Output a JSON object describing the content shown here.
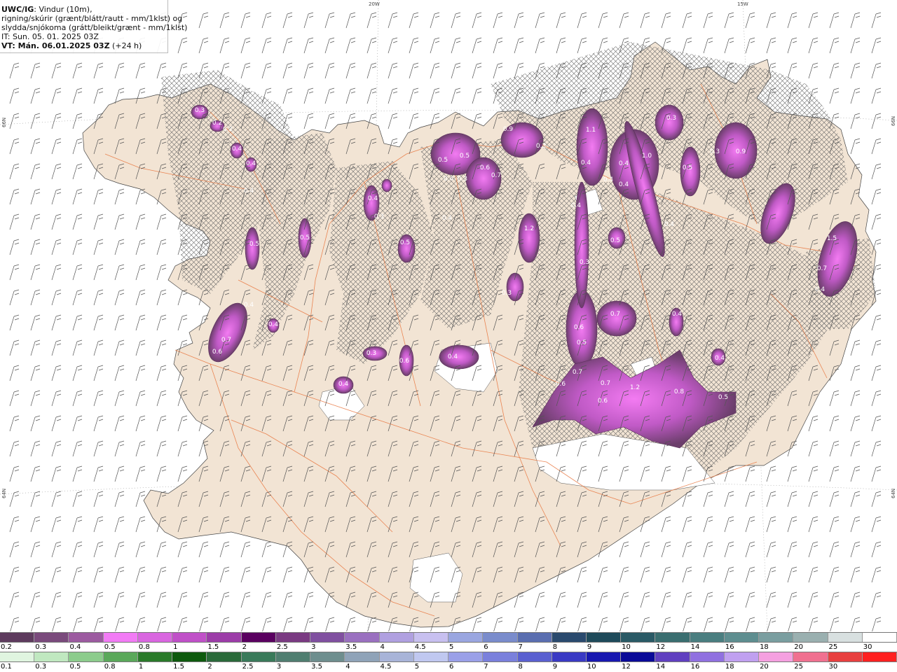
{
  "header": {
    "code": "UWC/IG",
    "line1_rest": ": Vindur (10m),",
    "line2": "rigning/skúrir (grænt/blátt/rautt - mm/1klst) og",
    "line3": "slydda/snjókoma (grátt/bleikt/grænt - mm/1klst)",
    "it": "IT: Sun. 05. 01. 2025 03Z",
    "vt": "VT: Mán. 06.01.2025 03Z",
    "vt_offset": " (+24 h)"
  },
  "grid_labels": {
    "lon_20w": "20W",
    "lon_15w": "15W",
    "lat_66n_left": "66N",
    "lat_66n_right": "66N",
    "lat_64n_left": "64N",
    "lat_64n_right": "64N"
  },
  "snow_values": [
    "0.3",
    "0.2",
    "0.2",
    "0.4",
    "0.4",
    "0.4",
    "0.5",
    "0.5",
    "0.4",
    "0.6",
    "0.7",
    "0.4",
    "0.3",
    "0.5",
    "0.5",
    "0.3",
    "0.9",
    "0.3",
    "1.2",
    "0.3",
    "0.4",
    "0.5",
    "1.1",
    "0.4",
    "1.0",
    "0.4",
    "0.4",
    "0.4",
    "0.5",
    "0.3",
    "0.9",
    "0.3",
    "0.4",
    "1.5",
    "0.7",
    "0.4",
    "0.6",
    "0.5",
    "0.5",
    "0.4",
    "0.4",
    "0.7",
    "0.4",
    "0.6",
    "0.7",
    "0.4",
    "0.3",
    "0.4",
    "0.6",
    "0.7",
    "0.7",
    "1.2",
    "0.8",
    "0.5",
    "0.4",
    "0.4",
    "0.3",
    "0.6",
    "0.6"
  ],
  "legend_top": {
    "scheme": "snow (grey/pink/green)",
    "labels": [
      "0.2",
      "0.3",
      "0.4",
      "0.5",
      "0.8",
      "1",
      "1.5",
      "2",
      "2.5",
      "3",
      "3.5",
      "4",
      "4.5",
      "5",
      "6",
      "7",
      "8",
      "9",
      "10",
      "12",
      "14",
      "16",
      "18",
      "20",
      "25",
      "30"
    ],
    "colors": [
      "#5e3b5e",
      "#7a4a7c",
      "#9c5aa0",
      "#f27bf5",
      "#d966e0",
      "#c050c8",
      "#9c3ca8",
      "#5a0060",
      "#7a3a82",
      "#8050a0",
      "#9a70c0",
      "#b0a0e0",
      "#c8c0f0",
      "#9aa6e0",
      "#7a8ccc",
      "#5a6eb0",
      "#2a4a6e",
      "#1e4a5a",
      "#2a5a66",
      "#3a6e70",
      "#4a7e80",
      "#5e8e90",
      "#7a9ea0",
      "#9ab0b0",
      "#d8e0e0",
      "#ffffff"
    ]
  },
  "legend_bottom": {
    "scheme": "rain (green/blue/red)",
    "labels": [
      "0.1",
      "0.3",
      "0.5",
      "0.8",
      "1",
      "1.5",
      "2",
      "2.5",
      "3",
      "3.5",
      "4",
      "4.5",
      "5",
      "6",
      "7",
      "8",
      "9",
      "10",
      "12",
      "14",
      "16",
      "18",
      "20",
      "25",
      "30"
    ],
    "colors": [
      "#e0f5e0",
      "#c0e8c0",
      "#8ccc8c",
      "#5aa85a",
      "#2a7a2a",
      "#0e5a0e",
      "#2a6a3a",
      "#3a7a5a",
      "#507e70",
      "#6e8e8e",
      "#8fa3b8",
      "#a8b4d8",
      "#c0c8f0",
      "#9aa0e8",
      "#7a80dc",
      "#5a60d0",
      "#3a3ac4",
      "#1818b0",
      "#0a0a98",
      "#6040c0",
      "#9070e0",
      "#c0a0f0",
      "#f5a0e0",
      "#f07090",
      "#e84040",
      "#ff2020"
    ]
  },
  "colors": {
    "land": "#f2e4d4",
    "sea": "#ffffff",
    "roads": "#e8743c",
    "hatch": "#555555",
    "snow_dark": "#6b3e6b",
    "snow_mid": "#a45aa8",
    "snow_light": "#f07bf0"
  }
}
